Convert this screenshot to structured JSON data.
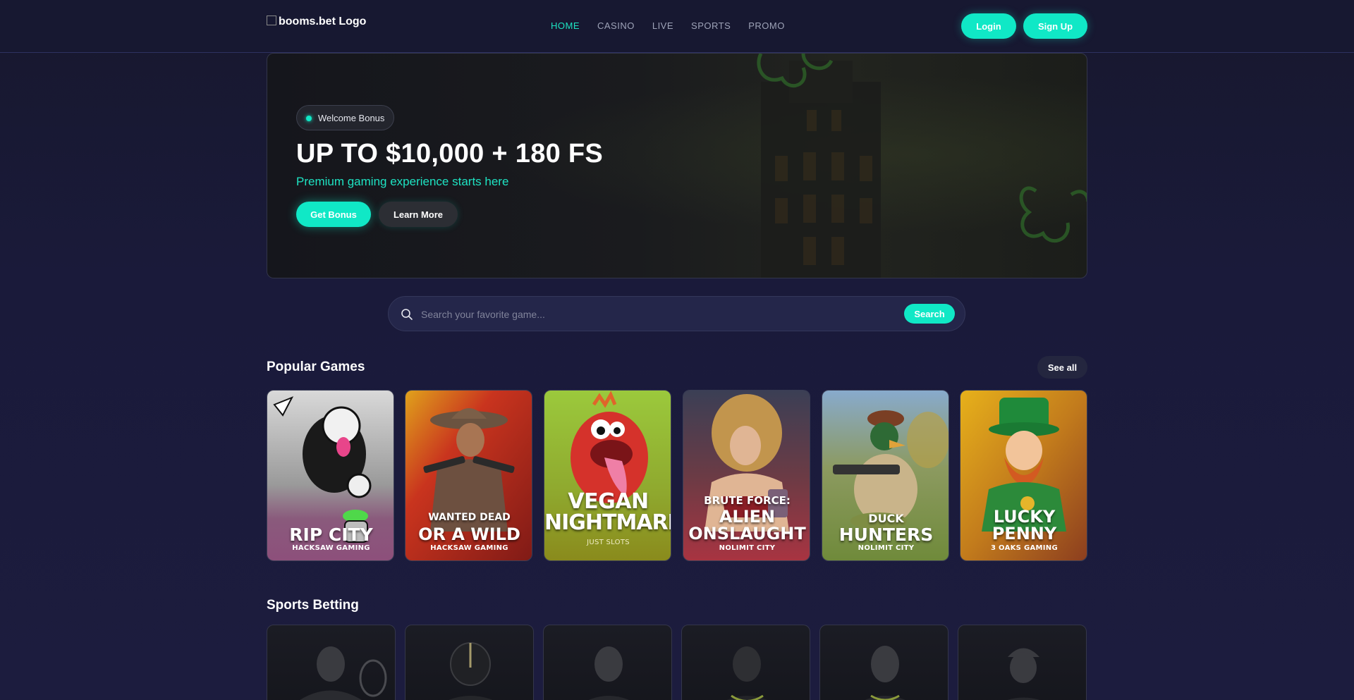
{
  "header": {
    "logo_alt": "booms.bet Logo",
    "nav": [
      "HOME",
      "CASINO",
      "LIVE",
      "SPORTS",
      "PROMO"
    ],
    "active_nav": "HOME",
    "login_label": "Login",
    "signup_label": "Sign Up"
  },
  "hero": {
    "badge": "Welcome Bonus",
    "title": "UP TO $10,000 + 180 FS",
    "subtitle": "Premium gaming experience starts here",
    "primary_button": "Get Bonus",
    "secondary_button": "Learn More"
  },
  "search": {
    "placeholder": "Search your favorite game...",
    "button_label": "Search"
  },
  "popular_games": {
    "title": "Popular Games",
    "see_all_label": "See all",
    "games": [
      {
        "pre": "",
        "title": [
          "RIP CITY"
        ],
        "provider": "HACKSAW GAMING"
      },
      {
        "pre": "WANTED DEAD",
        "title": [
          "OR A WILD"
        ],
        "provider": "HACKSAW GAMING"
      },
      {
        "pre": "",
        "title": [
          "VEGAN",
          "NIGHTMARE"
        ],
        "provider": "JUST SLOTS"
      },
      {
        "pre": "BRUTE FORCE:",
        "title": [
          "ALIEN",
          "ONSLAUGHT"
        ],
        "provider": "NOLIMIT CITY"
      },
      {
        "pre": "DUCK",
        "title": [
          "HUNTERS"
        ],
        "provider": "NOLIMIT CITY"
      },
      {
        "pre": "",
        "title": [
          "LUCKY",
          "PENNY"
        ],
        "provider": "3 OAKS GAMING"
      }
    ]
  },
  "sports_betting": {
    "title": "Sports Betting"
  },
  "colors": {
    "accent": "#10e8c6",
    "background": "#1a1a3a",
    "nav_inactive": "#9ea3b8"
  }
}
